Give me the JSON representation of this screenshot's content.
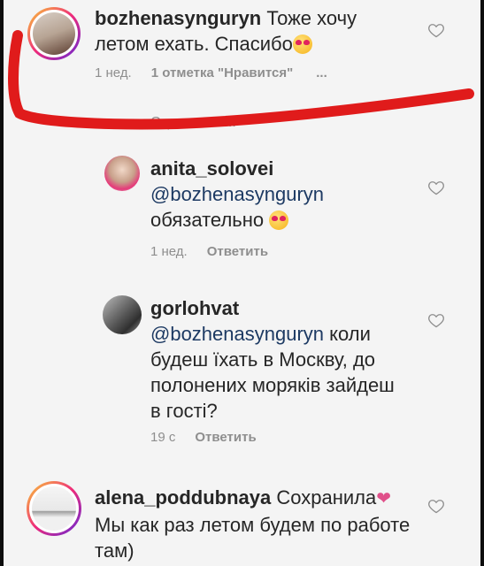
{
  "comments": [
    {
      "username": "bozhenasynguryn",
      "text": " Тоже хочу летом ехать. Спасибо",
      "time": "1 нед.",
      "likes": "1 отметка \"Нравится\"",
      "more": "...",
      "emoji": "heart-eyes-emoji"
    },
    {
      "hide_replies": "Скрыть отв..."
    },
    {
      "username": "anita_solovei",
      "mention": "@bozhenasynguryn",
      "text": "обязательно",
      "time": "1 нед.",
      "reply": "Ответить",
      "emoji": "heart-eyes-emoji"
    },
    {
      "username": "gorlohvat",
      "mention": "@bozhenasynguryn",
      "text": " коли будеш їхать в Москву, до полонених моряків зайдеш в гості?",
      "time": "19 с",
      "reply": "Ответить"
    },
    {
      "username": "alena_poddubnaya",
      "text": " Сохранила",
      "text2": "Мы как раз летом будем по работе там)",
      "emoji": "pink-heart"
    }
  ],
  "colors": {
    "annotation": "#e01b1b",
    "mention": "#1d3a63",
    "muted": "#8e8e8e"
  }
}
